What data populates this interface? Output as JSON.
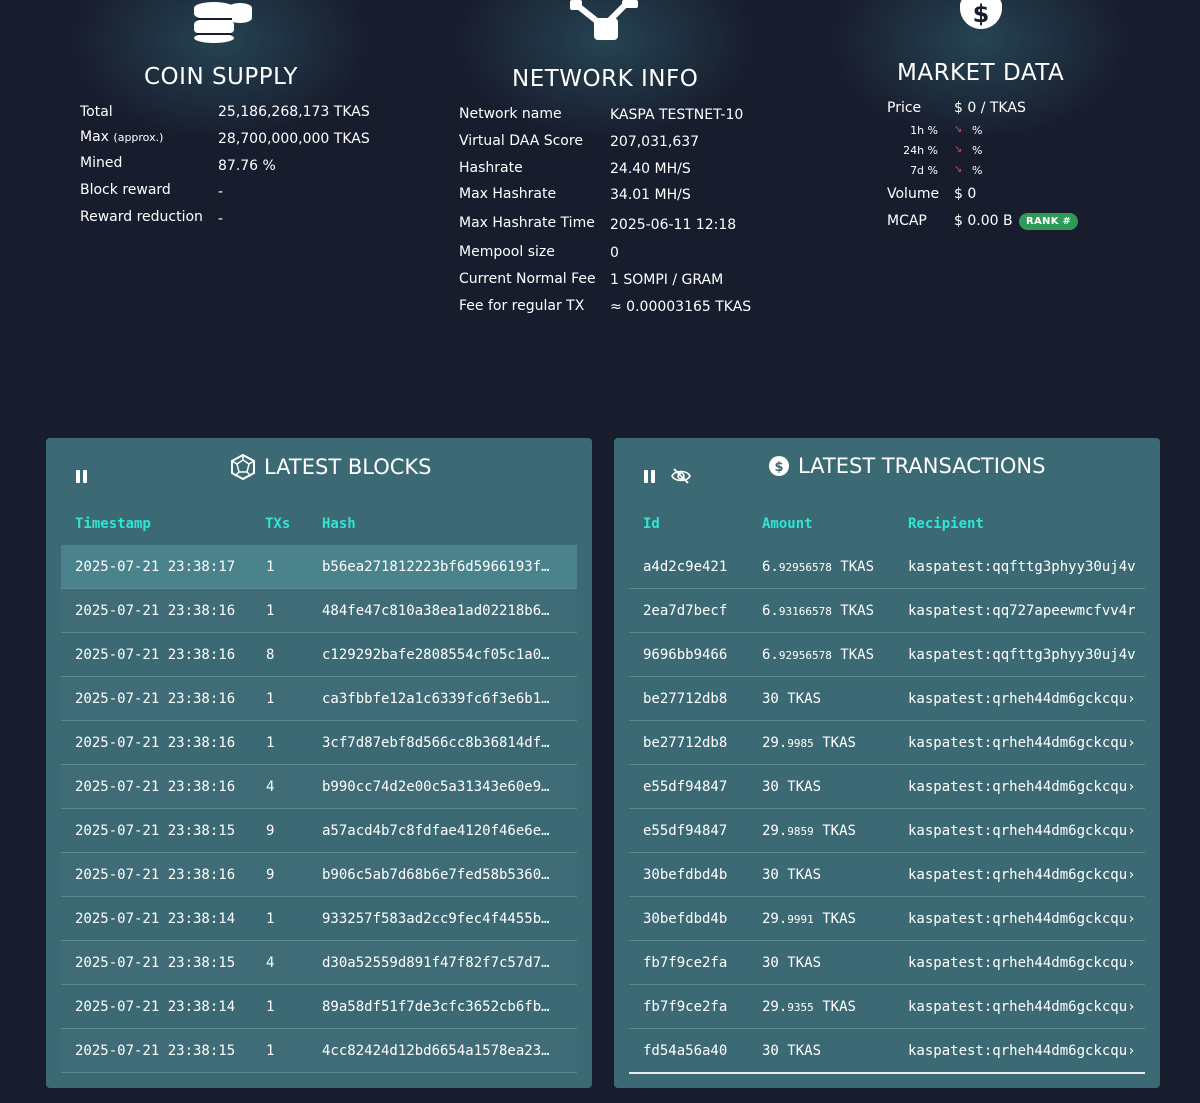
{
  "coin_supply": {
    "title": "COIN SUPPLY",
    "rows": [
      {
        "label": "Total",
        "value": "25,186,268,173 TKAS"
      },
      {
        "label": "Max",
        "label_note": "(approx.)",
        "value": "28,700,000,000 TKAS"
      },
      {
        "label": "Mined",
        "value": "87.76 %"
      },
      {
        "label": "Block reward",
        "value": "-"
      },
      {
        "label": "Reward reduction",
        "value": "-"
      }
    ]
  },
  "network_info": {
    "title": "NETWORK INFO",
    "rows": [
      {
        "label": "Network name",
        "value": "KASPA TESTNET-10"
      },
      {
        "label": "Virtual DAA Score",
        "value": "207,031,637"
      },
      {
        "label": "Hashrate",
        "value": "24.40 MH/S"
      },
      {
        "label": "Max Hashrate",
        "value": "34.01 MH/S"
      },
      {
        "label": "Max Hashrate Time",
        "value": "2025-06-11 12:18"
      },
      {
        "label": "Mempool size",
        "value": "0"
      },
      {
        "label": "Current Normal Fee",
        "value": "1 SOMPI / GRAM"
      },
      {
        "label": "Fee for regular TX",
        "value": "≈ 0.00003165 TKAS"
      }
    ]
  },
  "market_data": {
    "title": "MARKET DATA",
    "price_label": "Price",
    "price_value": "$ 0 / TKAS",
    "changes": [
      {
        "label": "1h %",
        "value": "%"
      },
      {
        "label": "24h %",
        "value": "%"
      },
      {
        "label": "7d %",
        "value": "%"
      }
    ],
    "volume_label": "Volume",
    "volume_value": "$ 0",
    "mcap_label": "MCAP",
    "mcap_value": "$ 0.00 B",
    "rank_badge": "RANK #"
  },
  "latest_blocks": {
    "title": "LATEST BLOCKS",
    "headers": {
      "timestamp": "Timestamp",
      "txs": "TXs",
      "hash": "Hash"
    },
    "rows": [
      {
        "timestamp": "2025-07-21 23:38:17",
        "txs": "1",
        "hash": "b56ea271812223bf6d5966193f…"
      },
      {
        "timestamp": "2025-07-21 23:38:16",
        "txs": "1",
        "hash": "484fe47c810a38ea1ad02218b6…"
      },
      {
        "timestamp": "2025-07-21 23:38:16",
        "txs": "8",
        "hash": "c129292bafe2808554cf05c1a0…"
      },
      {
        "timestamp": "2025-07-21 23:38:16",
        "txs": "1",
        "hash": "ca3fbbfe12a1c6339fc6f3e6b1…"
      },
      {
        "timestamp": "2025-07-21 23:38:16",
        "txs": "1",
        "hash": "3cf7d87ebf8d566cc8b36814df…"
      },
      {
        "timestamp": "2025-07-21 23:38:16",
        "txs": "4",
        "hash": "b990cc74d2e00c5a31343e60e9…"
      },
      {
        "timestamp": "2025-07-21 23:38:15",
        "txs": "9",
        "hash": "a57acd4b7c8fdfae4120f46e6e…"
      },
      {
        "timestamp": "2025-07-21 23:38:16",
        "txs": "9",
        "hash": "b906c5ab7d68b6e7fed58b5360…"
      },
      {
        "timestamp": "2025-07-21 23:38:14",
        "txs": "1",
        "hash": "933257f583ad2cc9fec4f4455b…"
      },
      {
        "timestamp": "2025-07-21 23:38:15",
        "txs": "4",
        "hash": "d30a52559d891f47f82f7c57d7…"
      },
      {
        "timestamp": "2025-07-21 23:38:14",
        "txs": "1",
        "hash": "89a58df51f7de3cfc3652cb6fb…"
      },
      {
        "timestamp": "2025-07-21 23:38:15",
        "txs": "1",
        "hash": "4cc82424d12bd6654a1578ea23…"
      }
    ]
  },
  "latest_transactions": {
    "title": "LATEST TRANSACTIONS",
    "headers": {
      "id": "Id",
      "amount": "Amount",
      "recipient": "Recipient"
    },
    "unit": "TKAS",
    "rows": [
      {
        "id": "a4d2c9e421",
        "amount_int": "6.",
        "amount_dec": "92956578",
        "recipient": "kaspatest:qqfttg3phyy30uj4v"
      },
      {
        "id": "2ea7d7becf",
        "amount_int": "6.",
        "amount_dec": "93166578",
        "recipient": "kaspatest:qq727apeewmcfvv4r"
      },
      {
        "id": "9696bb9466",
        "amount_int": "6.",
        "amount_dec": "92956578",
        "recipient": "kaspatest:qqfttg3phyy30uj4v"
      },
      {
        "id": "be27712db8",
        "amount_int": "30",
        "amount_dec": "",
        "recipient": "kaspatest:qrheh44dm6gckcqu›"
      },
      {
        "id": "be27712db8",
        "amount_int": "29.",
        "amount_dec": "9985",
        "recipient": "kaspatest:qrheh44dm6gckcqu›"
      },
      {
        "id": "e55df94847",
        "amount_int": "30",
        "amount_dec": "",
        "recipient": "kaspatest:qrheh44dm6gckcqu›"
      },
      {
        "id": "e55df94847",
        "amount_int": "29.",
        "amount_dec": "9859",
        "recipient": "kaspatest:qrheh44dm6gckcqu›"
      },
      {
        "id": "30befdbd4b",
        "amount_int": "30",
        "amount_dec": "",
        "recipient": "kaspatest:qrheh44dm6gckcqu›"
      },
      {
        "id": "30befdbd4b",
        "amount_int": "29.",
        "amount_dec": "9991",
        "recipient": "kaspatest:qrheh44dm6gckcqu›"
      },
      {
        "id": "fb7f9ce2fa",
        "amount_int": "30",
        "amount_dec": "",
        "recipient": "kaspatest:qrheh44dm6gckcqu›"
      },
      {
        "id": "fb7f9ce2fa",
        "amount_int": "29.",
        "amount_dec": "9355",
        "recipient": "kaspatest:qrheh44dm6gckcqu›"
      },
      {
        "id": "fd54a56a40",
        "amount_int": "30",
        "amount_dec": "",
        "recipient": "kaspatest:qrheh44dm6gckcqu›"
      }
    ]
  },
  "colors": {
    "background": "#181d2e",
    "panel": "#3c6a74",
    "row_highlight": "#4a838b",
    "header_accent": "#2ee6d2",
    "rank_badge": "#2f9a58",
    "negative_arrow": "#e04848"
  },
  "icons": {
    "coin_supply": "coin-stack-icon",
    "network_info": "network-nodes-icon",
    "market_data": "dollar-coin-icon",
    "latest_blocks": "block-polyhedron-icon",
    "latest_transactions": "dollar-circle-icon",
    "pause": "pause-icon",
    "hide": "eye-slash-icon",
    "trend": "trend-down-arrow-icon"
  }
}
